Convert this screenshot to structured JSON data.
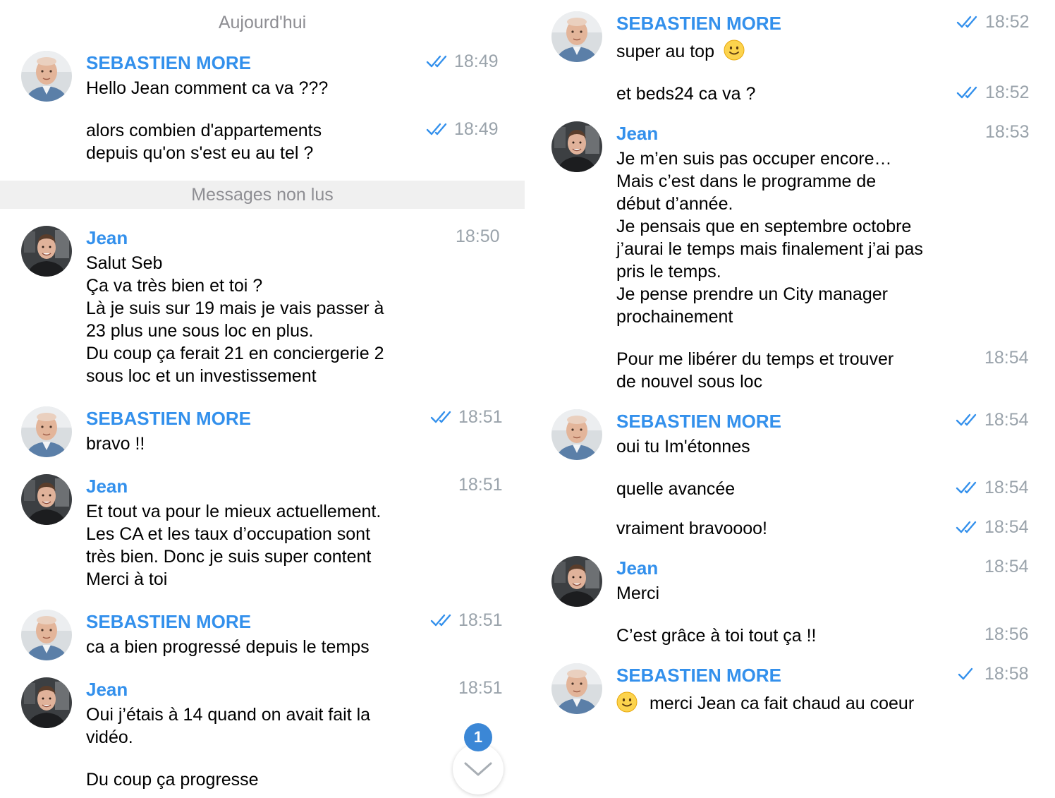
{
  "header": {
    "date_separator": "Aujourd'hui",
    "unread_label": "Messages non lus"
  },
  "participants": {
    "seb": "SEBASTIEN MORE",
    "jean": "Jean"
  },
  "colors": {
    "accent": "#3390ec",
    "time": "#9aa3ab",
    "badge": "#3b87d6"
  },
  "left": {
    "g1": {
      "name": "SEBASTIEN MORE",
      "time": "18:49",
      "text": "Hello Jean comment ca va ???"
    },
    "m2": {
      "time": "18:49",
      "line1": "alors combien d'appartements",
      "line2": "depuis qu'on s'est eu au tel ?"
    },
    "g2": {
      "name": "Jean",
      "time": "18:50",
      "lines": [
        "Salut Seb",
        "Ça va très bien et toi ?",
        "Là je suis sur 19 mais je vais passer à",
        "23 plus une sous loc en plus.",
        "Du coup ça ferait 21 en conciergerie 2",
        "sous loc et un investissement"
      ]
    },
    "g3": {
      "name": "SEBASTIEN MORE",
      "time": "18:51",
      "text": "bravo !!"
    },
    "g4": {
      "name": "Jean",
      "time": "18:51",
      "lines": [
        "Et tout va pour le mieux actuellement.",
        "Les CA et les taux d’occupation sont",
        "très bien. Donc je suis super content",
        "Merci à toi"
      ]
    },
    "g5": {
      "name": "SEBASTIEN MORE",
      "time": "18:51",
      "text": "ca a bien progressé depuis le temps"
    },
    "g6": {
      "name": "Jean",
      "time": "18:51",
      "line1": "Oui j’étais à 14 quand on avait fait la",
      "line2": "vidéo.",
      "line3": "Du coup ça progresse"
    },
    "unread_count": "1"
  },
  "right": {
    "g1": {
      "name": "SEBASTIEN MORE",
      "time": "18:52",
      "text": "super au top",
      "emoji": "slightly-smiling-face"
    },
    "m2": {
      "time": "18:52",
      "text": "et beds24 ca va ?"
    },
    "g2": {
      "name": "Jean",
      "time": "18:53",
      "lines": [
        "Je m’en suis pas occuper encore…",
        "Mais c’est dans le programme de",
        "début d’année.",
        "Je pensais que en septembre octobre",
        "j’aurai le temps mais finalement j’ai pas",
        "pris le temps.",
        "Je pense prendre un City manager",
        "prochainement"
      ]
    },
    "m3": {
      "time": "18:54",
      "line1": "Pour me libérer du temps et trouver",
      "line2": "de nouvel sous loc"
    },
    "g3": {
      "name": "SEBASTIEN MORE",
      "time": "18:54",
      "text": "oui tu Im'étonnes"
    },
    "m4": {
      "time": "18:54",
      "text": "quelle avancée"
    },
    "m5": {
      "time": "18:54",
      "text": "vraiment bravoooo!"
    },
    "g4": {
      "name": "Jean",
      "time": "18:54",
      "text": "Merci"
    },
    "m6": {
      "time": "18:56",
      "text": "C’est grâce à toi tout ça !!"
    },
    "g5": {
      "name": "SEBASTIEN MORE",
      "time": "18:58",
      "text": "merci Jean ca fait chaud au coeur",
      "emoji": "slightly-smiling-face"
    }
  }
}
